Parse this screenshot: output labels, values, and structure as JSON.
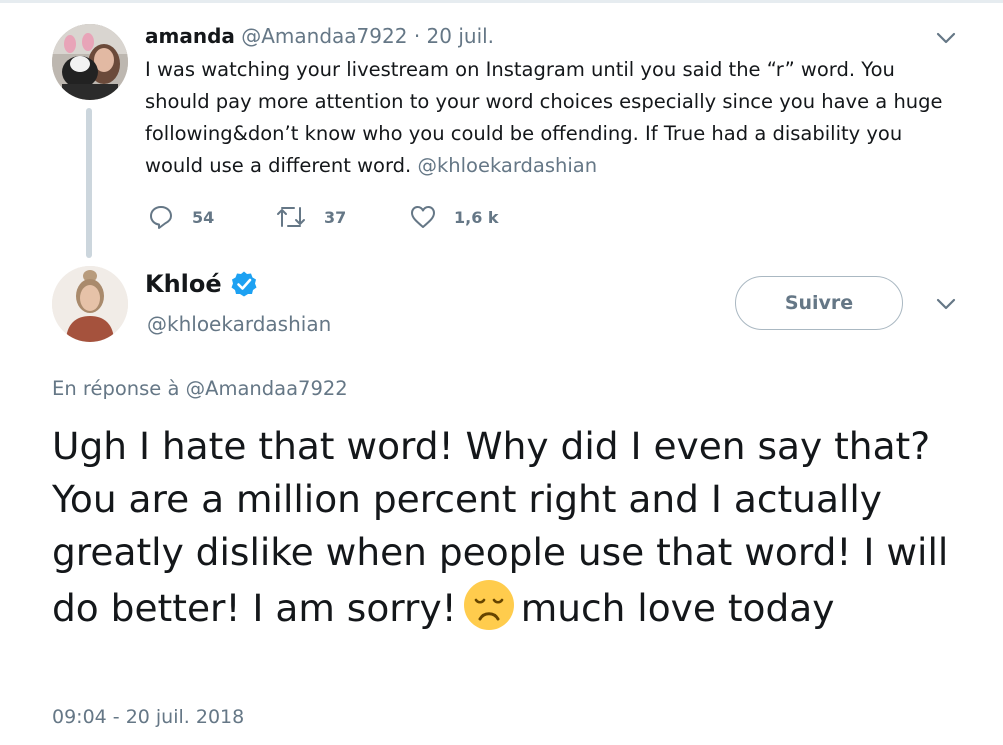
{
  "parent_tweet": {
    "author_name": "amanda",
    "handle": "@Amandaa7922",
    "separator": "·",
    "date": "20 juil.",
    "text": "I was watching your livestream on Instagram until you said the “r” word. You should pay more attention to your word choices especially since you have a huge following&don’t know who you could be offending.  If True had a disability you would use a different word.",
    "mention": "@khloekardashian",
    "stats": {
      "replies": "54",
      "retweets": "37",
      "likes": "1,6 k"
    }
  },
  "main_tweet": {
    "author_name": "Khloé",
    "handle": "@khloekardashian",
    "follow_label": "Suivre",
    "reply_to_prefix": "En réponse à",
    "reply_to_handle": "@Amandaa7922",
    "text_before_emoji": "Ugh I hate that word! Why did I even say that? You are a million percent right and I actually greatly dislike when people use that word! I will do better! I am sorry!",
    "text_after_emoji": "much love today",
    "emoji": "disappointed-face",
    "timestamp": "09:04 - 20 juil. 2018"
  },
  "colors": {
    "text_primary": "#14171a",
    "text_secondary": "#657786",
    "verified_blue": "#1da1f2",
    "thread_line": "#ccd6dd",
    "emoji_yellow": "#ffcc4d"
  }
}
